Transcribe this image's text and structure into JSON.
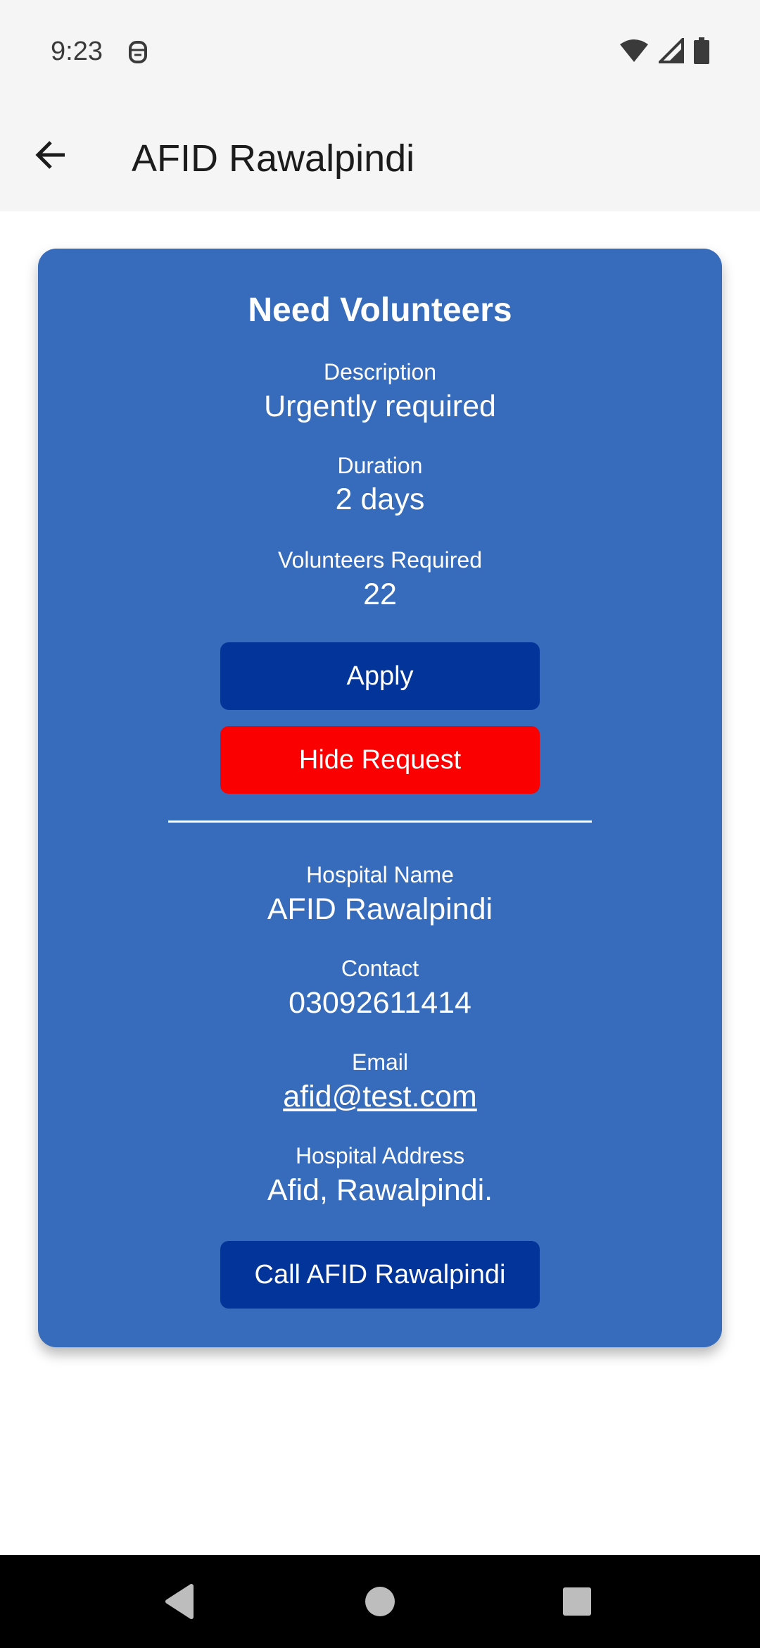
{
  "status_bar": {
    "time": "9:23",
    "icons": [
      "notification-icon",
      "wifi-icon",
      "signal-icon",
      "battery-icon"
    ]
  },
  "app_bar": {
    "title": "AFID Rawalpindi",
    "back_icon": "arrow-back-icon"
  },
  "card": {
    "title": "Need Volunteers",
    "description_label": "Description",
    "description_value": "Urgently required",
    "duration_label": "Duration",
    "duration_value": "2 days",
    "volunteers_label": "Volunteers Required",
    "volunteers_value": "22",
    "apply_label": "Apply",
    "hide_label": "Hide Request",
    "hospital_name_label": "Hospital Name",
    "hospital_name_value": "AFID Rawalpindi",
    "contact_label": "Contact",
    "contact_value": "03092611414",
    "email_label": "Email",
    "email_value": "afid@test.com",
    "address_label": "Hospital Address",
    "address_value": "Afid, Rawalpindi.",
    "call_label": "Call AFID Rawalpindi"
  },
  "colors": {
    "card_bg": "#376bbb",
    "primary_button": "#03349a",
    "danger_button": "#fb0000"
  },
  "nav_bar": {
    "icons": [
      "back-triangle-icon",
      "home-circle-icon",
      "recents-square-icon"
    ]
  }
}
